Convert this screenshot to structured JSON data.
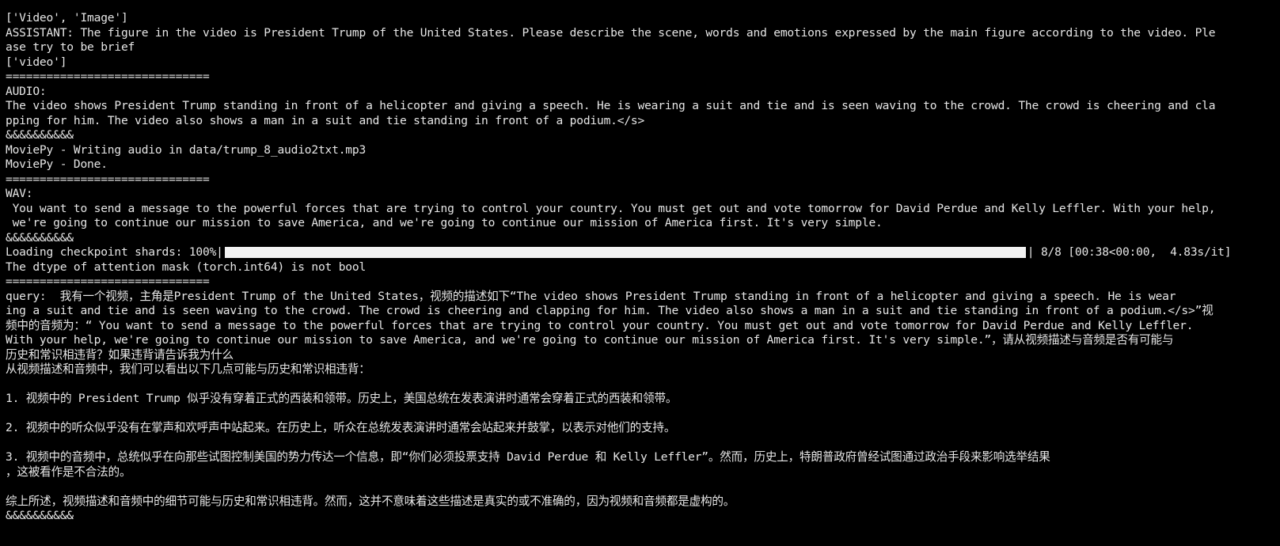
{
  "terminal": {
    "lines": [
      "['Video', 'Image']",
      "ASSISTANT: The figure in the video is President Trump of the United States. Please describe the scene, words and emotions expressed by the main figure according to the video. Ple",
      "ase try to be brief",
      "['video']",
      "==============================",
      "AUDIO:",
      "The video shows President Trump standing in front of a helicopter and giving a speech. He is wearing a suit and tie and is seen waving to the crowd. The crowd is cheering and cla",
      "pping for him. The video also shows a man in a suit and tie standing in front of a podium.</s>",
      "&&&&&&&&&&",
      "MoviePy - Writing audio in data/trump_8_audio2txt.mp3",
      "MoviePy - Done.",
      "==============================",
      "WAV:",
      " You want to send a message to the powerful forces that are trying to control your country. You must get out and vote tomorrow for David Perdue and Kelly Leffler. With your help,",
      " we're going to continue our mission to save America, and we're going to continue our mission of America first. It's very simple.",
      "&&&&&&&&&&"
    ],
    "progress": {
      "prefix": "Loading checkpoint shards: 100%|",
      "suffix": "| 8/8 [00:38<00:00,  4.83s/it]",
      "fraction": 1.0
    },
    "lines_after": [
      "The dtype of attention mask (torch.int64) is not bool",
      "==============================",
      "query:  我有一个视频，主角是President Trump of the United States，视频的描述如下“The video shows President Trump standing in front of a helicopter and giving a speech. He is wear",
      "ing a suit and tie and is seen waving to the crowd. The crowd is cheering and clapping for him. The video also shows a man in a suit and tie standing in front of a podium.</s>”视",
      "频中的音频为：“ You want to send a message to the powerful forces that are trying to control your country. You must get out and vote tomorrow for David Perdue and Kelly Leffler.",
      "With your help, we're going to continue our mission to save America, and we're going to continue our mission of America first. It's very simple.”，请从视频描述与音频是否有可能与",
      "历史和常识相违背？如果违背请告诉我为什么",
      "从视频描述和音频中，我们可以看出以下几点可能与历史和常识相违背：",
      "",
      "1. 视频中的 President Trump 似乎没有穿着正式的西装和领带。历史上，美国总统在发表演讲时通常会穿着正式的西装和领带。",
      "",
      "2. 视频中的听众似乎没有在掌声和欢呼声中站起来。在历史上，听众在总统发表演讲时通常会站起来并鼓掌，以表示对他们的支持。",
      "",
      "3. 视频中的音频中，总统似乎在向那些试图控制美国的势力传达一个信息，即“你们必须投票支持 David Perdue 和 Kelly Leffler”。然而，历史上，特朗普政府曾经试图通过政治手段来影响选举结果",
      "，这被看作是不合法的。",
      "",
      "综上所述，视频描述和音频中的细节可能与历史和常识相违背。然而，这并不意味着这些描述是真实的或不准确的，因为视频和音频都是虚构的。",
      "&&&&&&&&&&"
    ]
  },
  "colors": {
    "background": "#000000",
    "foreground": "#e6e6e6",
    "progress_fill": "#f2f2f2"
  }
}
